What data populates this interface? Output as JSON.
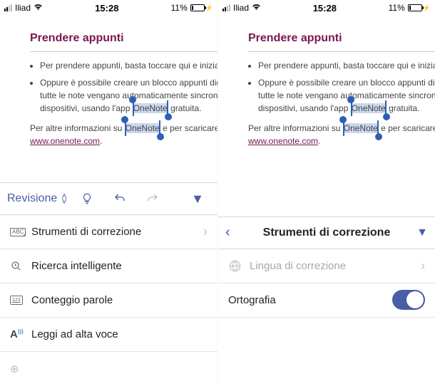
{
  "status": {
    "carrier": "Iliad",
    "time": "15:28",
    "battery_pct": "11%"
  },
  "document": {
    "title": "Prendere appunti",
    "bullet1": "Per prendere appunti, basta toccare qui e iniziare a digit",
    "bullet2_pre": "Oppure è possibile creare un blocco appunti digitale in m",
    "bullet2_mid": "tutte le note vengano automaticamente sincronizzate in",
    "bullet2_end_pre": "dispositivi, usando l'app ",
    "bullet2_sel": "OneNote",
    "bullet2_end_post": " gratuita.",
    "extra_pre": "Per altre informazioni su ",
    "extra_sel": "OneNote",
    "extra_post": " e per scaricare l'app, vis",
    "link": "www.onenote.com",
    "period": "."
  },
  "left_toolbar": {
    "tab": "Revisione"
  },
  "left_menu": {
    "proofing": "Strumenti di correzione",
    "smart_lookup": "Ricerca intelligente",
    "word_count": "Conteggio parole",
    "read_aloud": "Leggi ad alta voce"
  },
  "right_toolbar": {
    "title": "Strumenti di correzione"
  },
  "right_menu": {
    "language": "Lingua di correzione",
    "spelling": "Ortografia"
  }
}
